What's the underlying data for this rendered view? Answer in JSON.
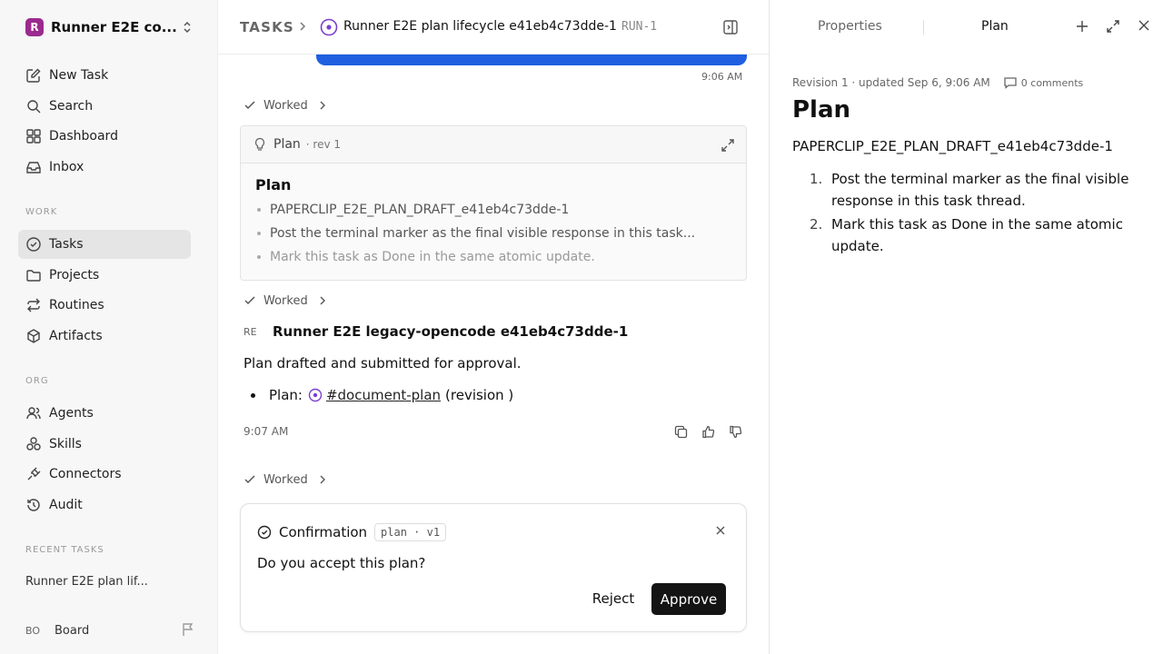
{
  "sidebar": {
    "workspace": {
      "initial": "R",
      "name": "Runner E2E co..."
    },
    "nav": [
      {
        "label": "New Task",
        "icon": "edit-icon"
      },
      {
        "label": "Search",
        "icon": "search-icon"
      },
      {
        "label": "Dashboard",
        "icon": "dashboard-icon"
      },
      {
        "label": "Inbox",
        "icon": "inbox-icon"
      }
    ],
    "work_label": "WORK",
    "work": [
      {
        "label": "Tasks",
        "icon": "check-circle-icon",
        "active": true
      },
      {
        "label": "Projects",
        "icon": "folder-icon"
      },
      {
        "label": "Routines",
        "icon": "repeat-icon"
      },
      {
        "label": "Artifacts",
        "icon": "cube-icon"
      }
    ],
    "org_label": "ORG",
    "org": [
      {
        "label": "Agents",
        "icon": "users-icon"
      },
      {
        "label": "Skills",
        "icon": "skills-icon"
      },
      {
        "label": "Connectors",
        "icon": "plug-icon"
      },
      {
        "label": "Audit",
        "icon": "history-icon"
      }
    ],
    "recent_label": "RECENT TASKS",
    "recent_item": "Runner E2E plan lif...",
    "board": {
      "initials": "BO",
      "name": "Board"
    }
  },
  "header": {
    "crumb_root": "TASKS",
    "title": "Runner E2E plan lifecycle e41eb4c73dde-1",
    "run_id": "RUN-1"
  },
  "thread": {
    "first_time": "9:06 AM",
    "worked_label": "Worked",
    "plan_card": {
      "label": "Plan",
      "rev": "· rev 1",
      "title": "Plan",
      "items": [
        "PAPERCLIP_E2E_PLAN_DRAFT_e41eb4c73dde-1",
        "Post the terminal marker as the final visible response in this task...",
        "Mark this task as Done in the same atomic update."
      ]
    },
    "agent": {
      "initials": "RE",
      "name": "Runner E2E legacy-opencode e41eb4c73dde-1",
      "message": "Plan drafted and submitted for approval.",
      "bullet_prefix": "Plan:",
      "bullet_link": "#document-plan",
      "bullet_suffix": "(revision )",
      "time": "9:07 AM"
    },
    "confirmation": {
      "title": "Confirmation",
      "tag": "plan · v1",
      "question": "Do you accept this plan?",
      "reject": "Reject",
      "approve": "Approve"
    }
  },
  "right_panel": {
    "tab_properties": "Properties",
    "tab_plan": "Plan",
    "meta": "Revision 1 · updated Sep 6, 9:06 AM",
    "comments": "0 comments",
    "title": "Plan",
    "draft": "PAPERCLIP_E2E_PLAN_DRAFT_e41eb4c73dde-1",
    "steps": [
      {
        "num": "1.",
        "text": "Post the terminal marker as the final visible response in this task thread."
      },
      {
        "num": "2.",
        "text": "Mark this task as Done in the same atomic update."
      }
    ]
  },
  "colors": {
    "accent_purple": "#7b3fd0",
    "brand_logo": "#9b2a8f",
    "user_bubble": "#1f5fe0",
    "primary_button": "#141414"
  }
}
